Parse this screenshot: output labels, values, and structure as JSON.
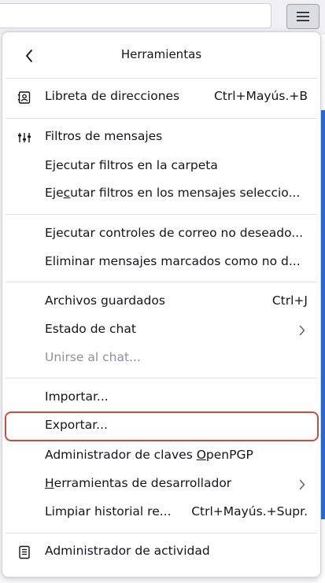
{
  "menu": {
    "title": "Herramientas",
    "items": [
      {
        "id": "address-book",
        "label": "Libreta de direcciones",
        "shortcut": "Ctrl+Mayús.+B",
        "icon": "address-book-icon"
      },
      {
        "id": "message-filters",
        "label": "Filtros de mensajes",
        "icon": "filters-icon"
      },
      {
        "id": "run-filters-folder",
        "label": "Ejecutar filtros en la carpeta"
      },
      {
        "id": "run-filters-selected",
        "label_pre": "Eje",
        "label_ul": "c",
        "label_post": "utar filtros en los mensajes seleccio..."
      },
      {
        "id": "run-junk-controls",
        "label": "Ejecutar controles de correo no deseado..."
      },
      {
        "id": "delete-junk",
        "label": "Eliminar mensajes marcados como no d..."
      },
      {
        "id": "saved-files",
        "label": "Archivos guardados",
        "shortcut": "Ctrl+J"
      },
      {
        "id": "chat-status",
        "label": "Estado de chat"
      },
      {
        "id": "join-chat",
        "label": "Unirse al chat...",
        "disabled": true
      },
      {
        "id": "import",
        "label": "Importar..."
      },
      {
        "id": "export",
        "label": "Exportar..."
      },
      {
        "id": "openpgp-key-manager",
        "label_pre": "Administrador de claves ",
        "label_ul": "O",
        "label_post": "penPGP"
      },
      {
        "id": "developer-tools",
        "label_ul": "H",
        "label_post": "erramientas de desarrollador"
      },
      {
        "id": "clear-history",
        "label": "Limpiar historial re...",
        "shortcut": "Ctrl+Mayús.+Supr."
      },
      {
        "id": "activity-manager",
        "label": "Administrador de actividad",
        "icon": "activity-manager-icon"
      }
    ]
  },
  "colors": {
    "highlight_border": "#cf4b3c",
    "disabled_text": "#8f8f9d"
  }
}
